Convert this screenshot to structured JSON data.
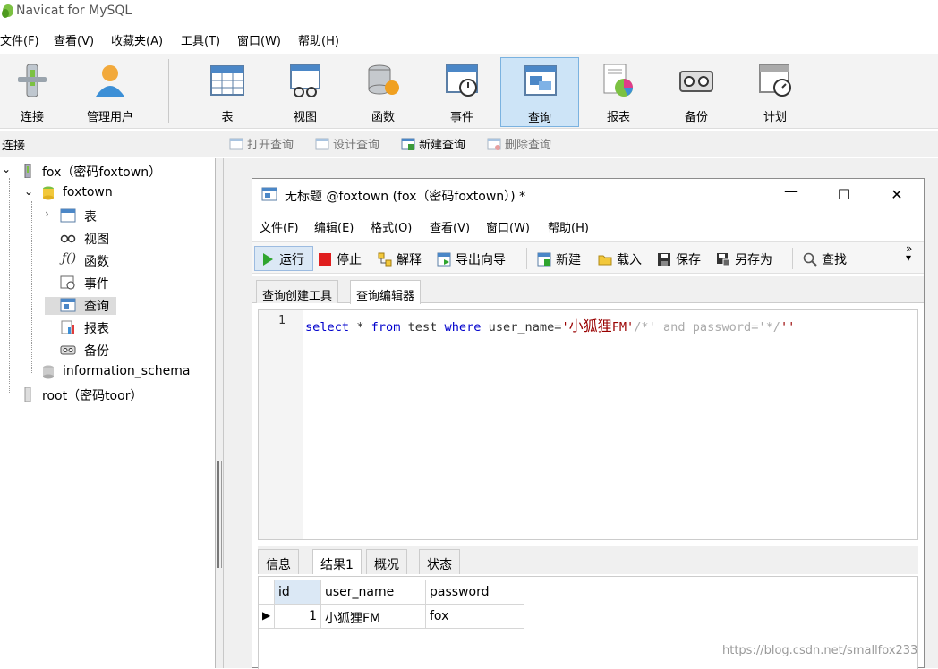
{
  "app": {
    "title": "Navicat for MySQL"
  },
  "menu": [
    "文件(F)",
    "查看(V)",
    "收藏夹(A)",
    "工具(T)",
    "窗口(W)",
    "帮助(H)"
  ],
  "toolbar": {
    "connect": "连接",
    "manage_users": "管理用户",
    "table": "表",
    "view": "视图",
    "function": "函数",
    "event": "事件",
    "query": "查询",
    "report": "报表",
    "backup": "备份",
    "schedule": "计划"
  },
  "subtoolbar": {
    "header": "连接",
    "open_query": "打开查询",
    "design_query": "设计查询",
    "new_query": "新建查询",
    "delete_query": "删除查询"
  },
  "tree": {
    "conn_fox": "fox（密码foxtown）",
    "db_foxtown": "foxtown",
    "tables": "表",
    "views": "视图",
    "functions": "函数",
    "events": "事件",
    "queries": "查询",
    "reports": "报表",
    "backups": "备份",
    "db_info": "information_schema",
    "conn_root": "root（密码toor）"
  },
  "query_window": {
    "title": "无标题 @foxtown (fox（密码foxtown）) *",
    "minimize": "—",
    "maximize": "☐",
    "close": "✕",
    "menu": [
      "文件(F)",
      "编辑(E)",
      "格式(O)",
      "查看(V)",
      "窗口(W)",
      "帮助(H)"
    ],
    "toolbar": {
      "run": "运行",
      "stop": "停止",
      "explain": "解释",
      "export_wizard": "导出向导",
      "new": "新建",
      "load": "载入",
      "save": "保存",
      "save_as": "另存为",
      "find": "查找",
      "more": "»"
    },
    "editor_tabs": [
      "查询创建工具",
      "查询编辑器"
    ],
    "editor": {
      "line_number": "1",
      "code": {
        "kw_select": "select",
        "star": " * ",
        "kw_from": "from",
        "table": " test ",
        "kw_where": "where",
        "cond": " user_name=",
        "str_open": "'",
        "cjk_value": "小狐狸",
        "str_rest": "FM'",
        "comment": "/*' and password='*/",
        "trail": "''"
      }
    },
    "result_tabs": [
      "信息",
      "结果1",
      "概况",
      "状态"
    ],
    "grid": {
      "columns": [
        "id",
        "user_name",
        "password"
      ],
      "rows": [
        {
          "marker": "▶",
          "id": "1",
          "user_name": "小狐狸FM",
          "password": "fox"
        }
      ]
    }
  },
  "watermark": "https://blog.csdn.net/smallfox233",
  "colors": {
    "keyword": "#0000cc",
    "string": "#990000",
    "comment": "#aaaaaa",
    "selected_bg": "#cde4f7"
  }
}
